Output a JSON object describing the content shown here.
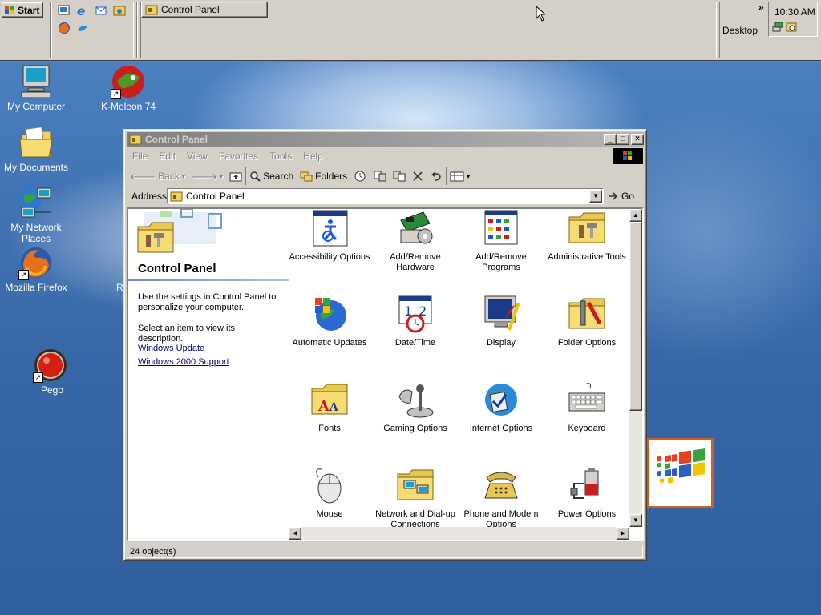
{
  "taskbar": {
    "start_label": "Start",
    "task_button_label": "Control Panel",
    "desktop_label": "Desktop",
    "chevron": "»",
    "clock": "10:30 AM"
  },
  "desktop_icons": [
    {
      "label": "My Computer"
    },
    {
      "label": "K-Meleon 74"
    },
    {
      "label": "My Documents"
    },
    {
      "label": "My Network Places"
    },
    {
      "label": "Mozilla Firefox"
    },
    {
      "label": "Pego"
    },
    {
      "label": "R"
    }
  ],
  "window": {
    "title": "Control Panel",
    "menu": [
      "File",
      "Edit",
      "View",
      "Favorites",
      "Tools",
      "Help"
    ],
    "toolbar": {
      "back": "Back",
      "search": "Search",
      "folders": "Folders"
    },
    "address_label": "Address",
    "address_value": "Control Panel",
    "go_label": "Go",
    "left_pane": {
      "title": "Control Panel",
      "desc1": "Use the settings in Control Panel to personalize your computer.",
      "desc2": "Select an item to view its description.",
      "link1": "Windows Update",
      "link2": "Windows 2000 Support"
    },
    "items": [
      {
        "label": "Accessibility Options",
        "icon": "accessibility-icon"
      },
      {
        "label": "Add/Remove Hardware",
        "icon": "hardware-icon"
      },
      {
        "label": "Add/Remove Programs",
        "icon": "programs-icon"
      },
      {
        "label": "Administrative Tools",
        "icon": "admin-tools-icon"
      },
      {
        "label": "Automatic Updates",
        "icon": "updates-icon"
      },
      {
        "label": "Date/Time",
        "icon": "calendar-clock-icon"
      },
      {
        "label": "Display",
        "icon": "monitor-icon"
      },
      {
        "label": "Folder Options",
        "icon": "folder-options-icon"
      },
      {
        "label": "Fonts",
        "icon": "fonts-folder-icon"
      },
      {
        "label": "Gaming Options",
        "icon": "joystick-icon"
      },
      {
        "label": "Internet Options",
        "icon": "globe-icon"
      },
      {
        "label": "Keyboard",
        "icon": "keyboard-icon"
      },
      {
        "label": "Mouse",
        "icon": "mouse-icon"
      },
      {
        "label": "Network and Dial-up Connections",
        "icon": "network-folder-icon"
      },
      {
        "label": "Phone and Modem Options",
        "icon": "phone-icon"
      },
      {
        "label": "Power Options",
        "icon": "power-icon"
      }
    ],
    "status": "24 object(s)"
  },
  "colors": {
    "desktop": "#3a6ea5",
    "face": "#d4d0c8",
    "titlebar_inactive": "#808080",
    "link": "#00007f"
  }
}
